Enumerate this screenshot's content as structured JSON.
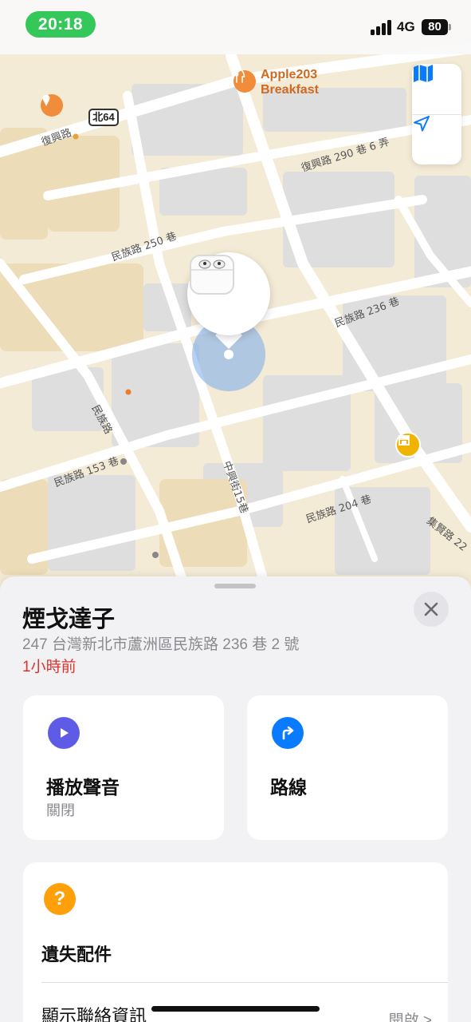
{
  "status_bar": {
    "time": "20:18",
    "network": "4G",
    "battery": "80"
  },
  "map": {
    "poi_name_line1": "Apple203",
    "poi_name_line2": "Breakfast",
    "route_shield": "北64",
    "streets": {
      "fuxing_road": "復興路",
      "fuxing_lane": "復興路 290 巷 6 弄",
      "minzu_250": "民族路 250 巷",
      "minzu_236": "民族路 236 巷",
      "minzu_road": "民族路",
      "minzu_153": "民族路 153 巷",
      "zhongxing_15": "中興街15巷",
      "minzu_204": "民族路 204 巷",
      "jixian_road": "集賢路 22"
    }
  },
  "sheet": {
    "title": "煙戈達子",
    "address": "247 台灣新北市蘆洲區民族路 236 巷 2 號",
    "last_seen": "1小時前",
    "play_sound": {
      "title": "播放聲音",
      "status": "關閉"
    },
    "directions": {
      "title": "路線"
    },
    "lost": {
      "title": "遺失配件",
      "contact_label": "顯示聯絡資訊",
      "contact_value": "開啟 >"
    }
  },
  "colors": {
    "accent_blue": "#0a7aff",
    "play_purple": "#5e5ce6",
    "warning_orange": "#ff9f0a",
    "time_green": "#34c759",
    "alert_red": "#e0322d"
  },
  "icons": [
    "map-icon",
    "location-arrow-icon",
    "play-icon",
    "turn-right-icon",
    "question-icon",
    "close-icon",
    "airpods-icon",
    "fork-knife-icon",
    "ice-cream-icon",
    "shop-icon"
  ]
}
